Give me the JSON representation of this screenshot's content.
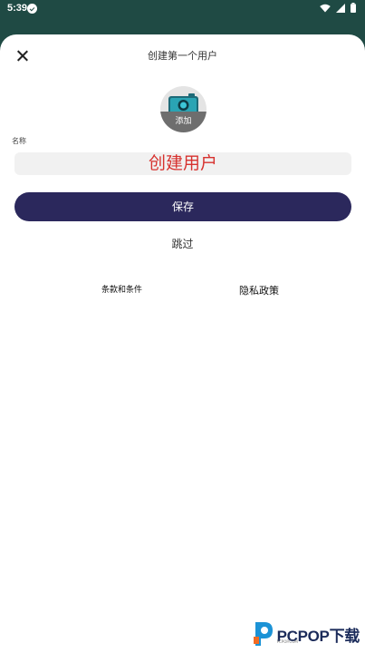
{
  "status_bar": {
    "time": "5:39",
    "icons": [
      "app-check-icon",
      "wifi-icon",
      "signal-icon",
      "battery-icon"
    ]
  },
  "dialog": {
    "title": "创建第一个用户",
    "avatar_label": "添加",
    "name_label": "名称",
    "name_value": "创建用户",
    "save_label": "保存",
    "skip_label": "跳过",
    "terms_label": "条款和条件",
    "privacy_label": "隐私政策"
  },
  "watermark": {
    "brand": "PCPOP下载",
    "subtitle": "PCPOP.COM"
  },
  "colors": {
    "status_bar_bg": "#1f4a44",
    "primary_button": "#2b285c",
    "input_text": "#d7322f",
    "input_bg": "#f1f1f1"
  }
}
